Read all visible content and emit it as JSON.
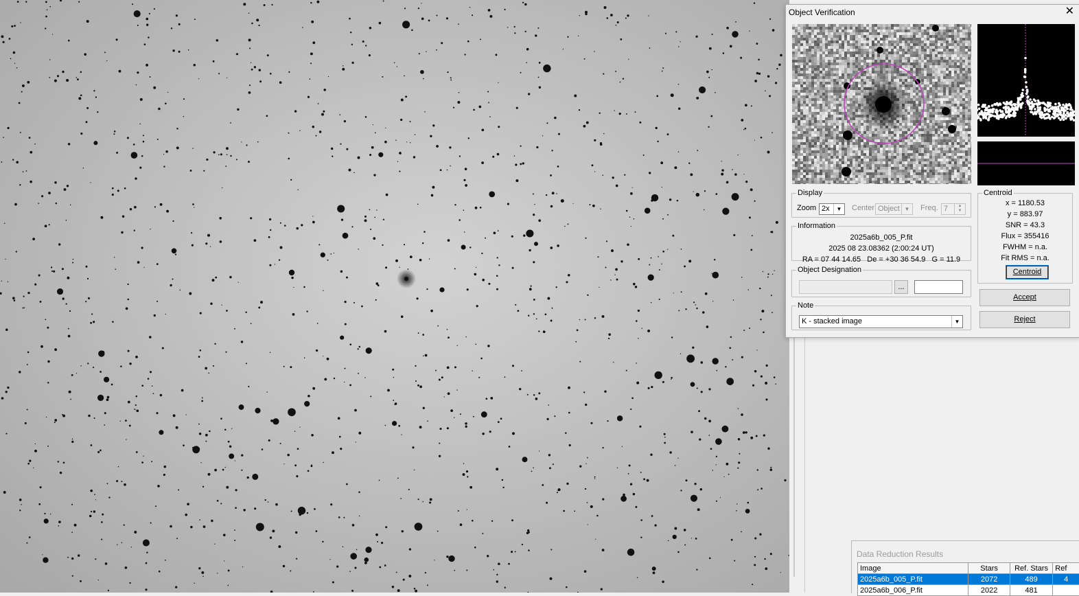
{
  "window": {
    "title": "Object Verification",
    "close_glyph": "✕"
  },
  "display": {
    "legend": "Display",
    "zoom_label": "Zoom",
    "zoom_value": "2x",
    "center_label": "Center",
    "center_value": "Object",
    "freq_label": "Freq.",
    "freq_value": "7"
  },
  "information": {
    "legend": "Information",
    "filename": "2025a6b_005_P.fit",
    "datetime": "2025 08 23.08362 (2:00:24 UT)",
    "coords": "RA = 07 44 14.65   De = +30 36 54.9   G = 11.9"
  },
  "centroid": {
    "legend": "Centroid",
    "x": "x = 1180.53",
    "y": "y = 883.97",
    "snr": "SNR = 43.3",
    "flux": "Flux = 355416",
    "fwhm": "FWHM = n.a.",
    "fit_rms": "Fit RMS = n.a.",
    "button": "Centroid"
  },
  "designation": {
    "legend": "Object Designation",
    "browse_label": "..."
  },
  "note": {
    "legend": "Note",
    "value": "K - stacked image"
  },
  "actions": {
    "accept": "Accept",
    "reject": "Reject"
  },
  "results": {
    "title": "Data Reduction Results",
    "columns": [
      "Image",
      "Stars",
      "Ref. Stars",
      "Ref"
    ],
    "rows": [
      {
        "image": "2025a6b_005_P.fit",
        "stars": "2072",
        "ref_stars": "489",
        "ref": "4"
      },
      {
        "image": "2025a6b_006_P.fit",
        "stars": "2022",
        "ref_stars": "481",
        "ref": ""
      }
    ]
  },
  "colors": {
    "aperture_circle": "#c042c0",
    "profile_marker": "#d040d0",
    "selection": "#0078d7"
  }
}
